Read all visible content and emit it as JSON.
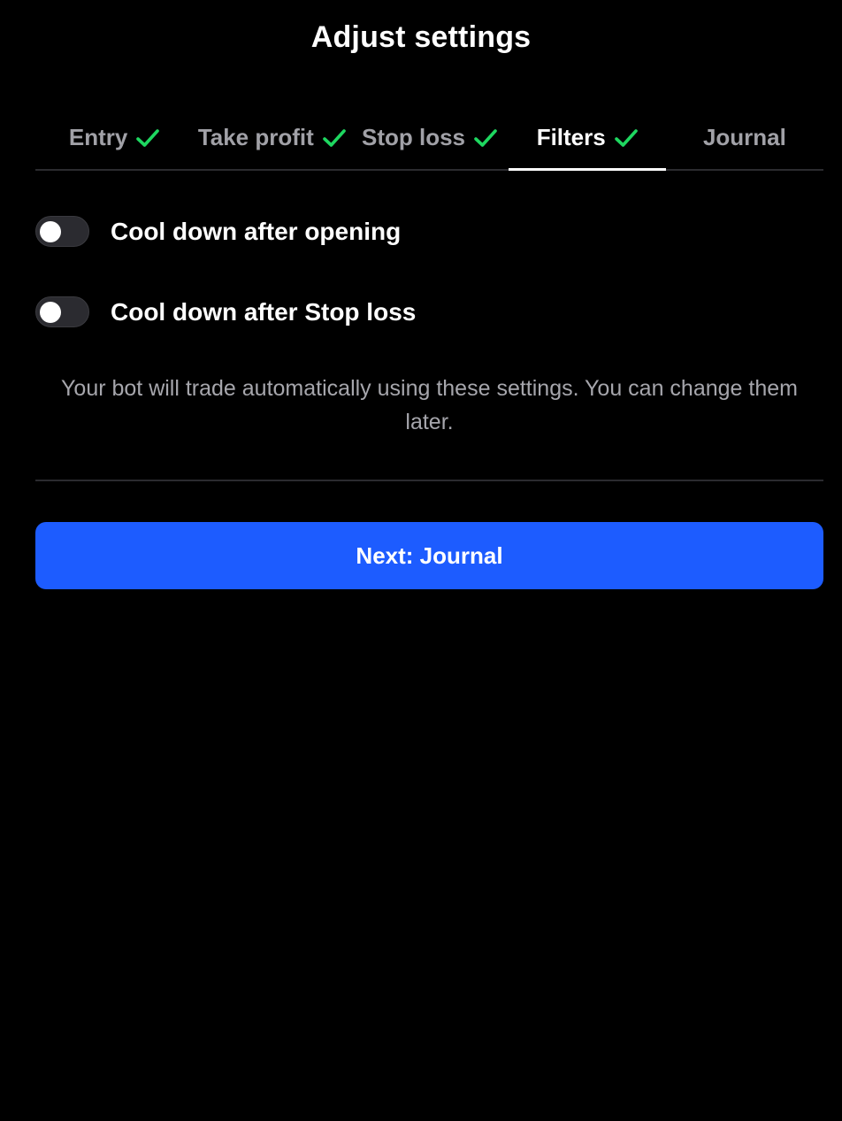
{
  "header": {
    "title": "Adjust settings"
  },
  "tabs": [
    {
      "label": "Entry",
      "completed": true,
      "active": false
    },
    {
      "label": "Take profit",
      "completed": true,
      "active": false
    },
    {
      "label": "Stop loss",
      "completed": true,
      "active": false
    },
    {
      "label": "Filters",
      "completed": true,
      "active": true
    },
    {
      "label": "Journal",
      "completed": false,
      "active": false
    }
  ],
  "filters": {
    "cooldown_after_opening": {
      "label": "Cool down after opening",
      "enabled": false
    },
    "cooldown_after_stop_loss": {
      "label": "Cool down after Stop loss",
      "enabled": false
    }
  },
  "info": {
    "text": "Your bot will trade automatically using these settings. You can change them later."
  },
  "actions": {
    "next_label": "Next: Journal"
  },
  "colors": {
    "background": "#000000",
    "accent": "#1d5cff",
    "check": "#1ed760",
    "muted_text": "#a1a1a7"
  }
}
